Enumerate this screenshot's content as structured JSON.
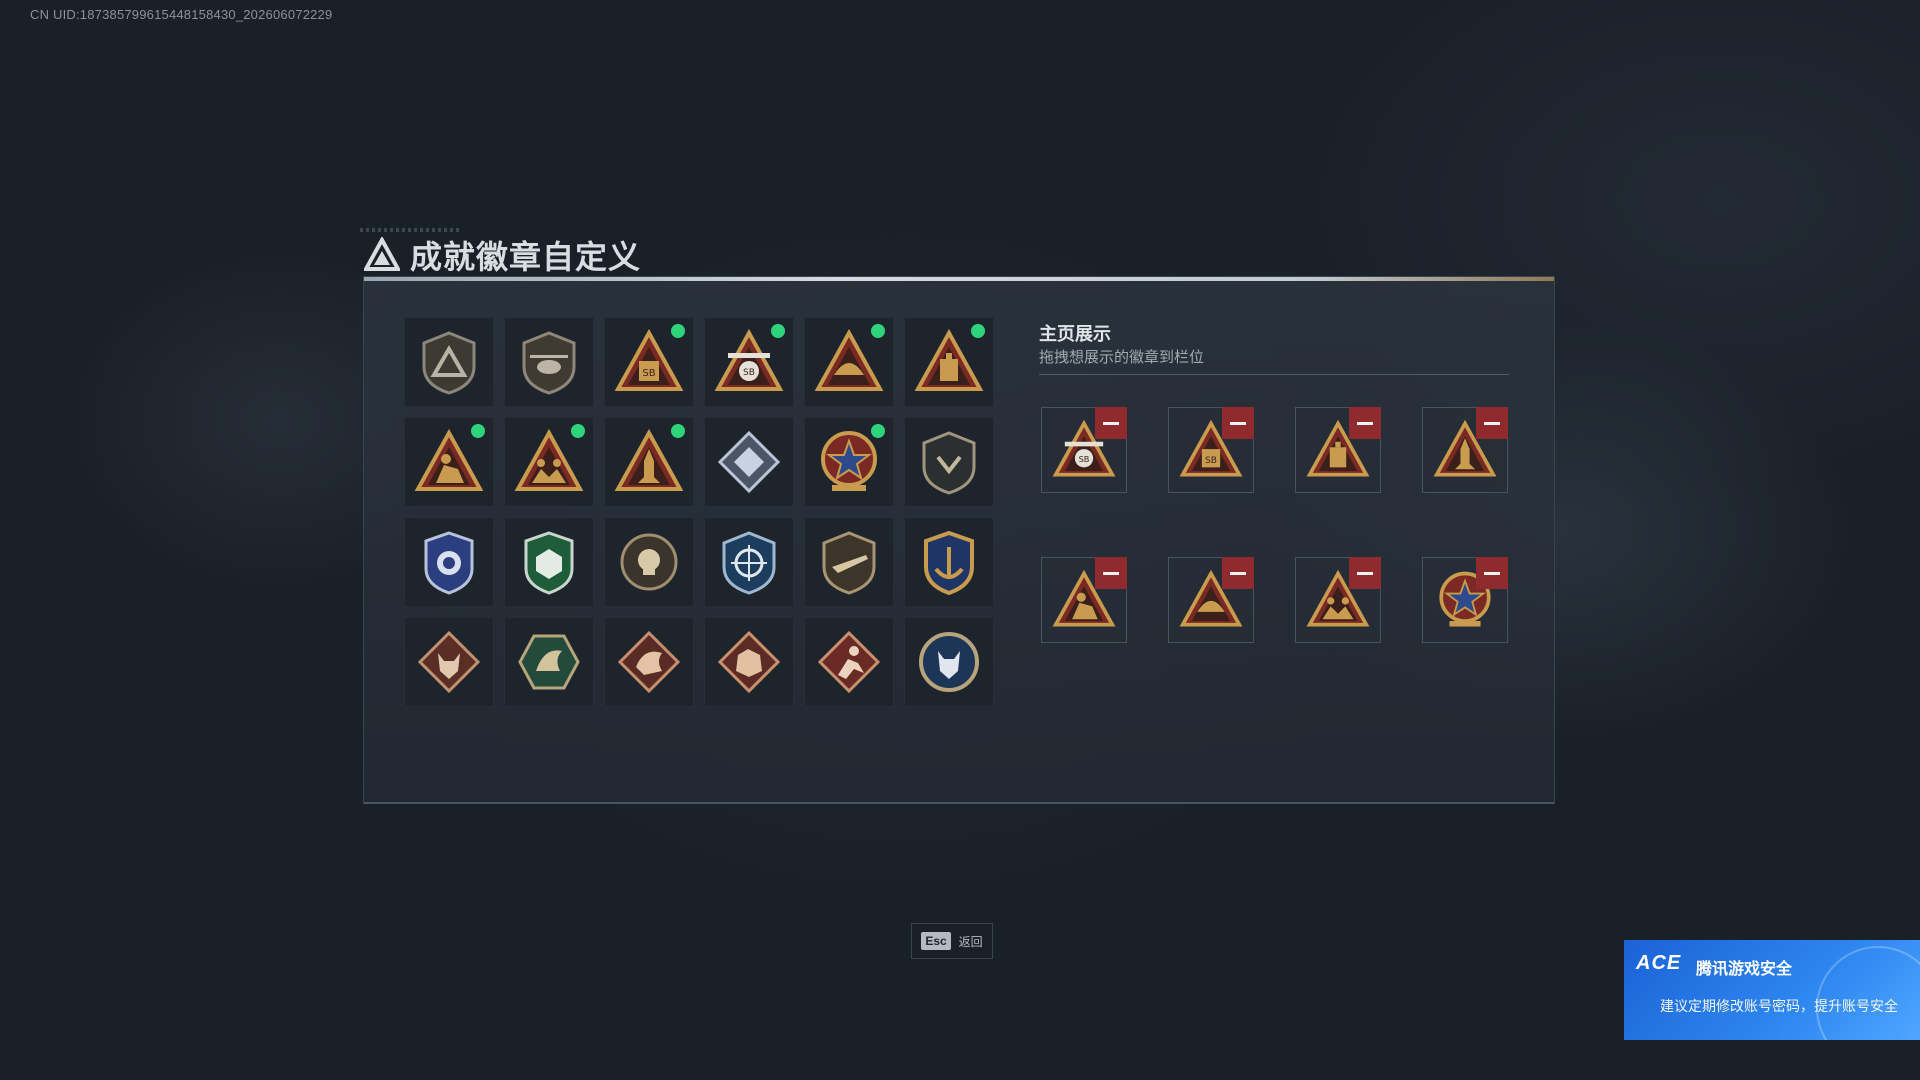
{
  "uid_text": "CN UID:187385799615448158430_202606072229",
  "title": "成就徽章自定义",
  "colors": {
    "selected_dot": "#2fd37c",
    "remove_bg": "#8f2a2e",
    "gold": "#c89b4e",
    "red": "#7a2a23",
    "notice_bg": "#2e86f0"
  },
  "badges": [
    {
      "icon": "gray-shield-triangle-badge-icon",
      "selected": false
    },
    {
      "icon": "helicopter-shield-badge-icon",
      "selected": false
    },
    {
      "icon": "sb-crate-triangle-badge-icon",
      "selected": true
    },
    {
      "icon": "sb-drone-triangle-badge-icon",
      "selected": true
    },
    {
      "icon": "helmet-triangle-badge-icon",
      "selected": true
    },
    {
      "icon": "box-triangle-badge-icon",
      "selected": true
    },
    {
      "icon": "soldier-triangle-badge-icon",
      "selected": true
    },
    {
      "icon": "squad-triangle-badge-icon",
      "selected": true
    },
    {
      "icon": "rocket-triangle-badge-icon",
      "selected": true
    },
    {
      "icon": "dice-diamond-badge-icon",
      "selected": false
    },
    {
      "icon": "star-wreath-badge-icon",
      "selected": true
    },
    {
      "icon": "dark-shield-badge-icon",
      "selected": false
    },
    {
      "icon": "blue-police-badge-icon",
      "selected": false
    },
    {
      "icon": "green-shield-badge-icon",
      "selected": false
    },
    {
      "icon": "skull-medal-badge-icon",
      "selected": false
    },
    {
      "icon": "crosshair-shield-badge-icon",
      "selected": false
    },
    {
      "icon": "rifle-shield-badge-icon",
      "selected": false
    },
    {
      "icon": "gold-anchor-badge-icon",
      "selected": false
    },
    {
      "icon": "wolf-diamond-badge-icon",
      "selected": false
    },
    {
      "icon": "dragon-hexagon-badge-icon",
      "selected": false
    },
    {
      "icon": "dragon-diamond-badge-icon",
      "selected": false
    },
    {
      "icon": "beast-diamond-badge-icon",
      "selected": false
    },
    {
      "icon": "runner-diamond-badge-icon",
      "selected": false
    },
    {
      "icon": "wolf-circle-badge-icon",
      "selected": false
    }
  ],
  "showcase": {
    "title": "主页展示",
    "subtitle": "拖拽想展示的徽章到栏位",
    "slots": [
      {
        "icon": "sb-drone-triangle-badge-icon"
      },
      {
        "icon": "sb-crate-triangle-badge-icon"
      },
      {
        "icon": "box-triangle-badge-icon"
      },
      {
        "icon": "rocket-triangle-badge-icon"
      },
      {
        "icon": "soldier-triangle-badge-icon"
      },
      {
        "icon": "helmet-triangle-badge-icon"
      },
      {
        "icon": "squad-triangle-badge-icon"
      },
      {
        "icon": "star-wreath-badge-icon"
      }
    ]
  },
  "esc": {
    "key": "Esc",
    "label": "返回"
  },
  "notice": {
    "logo": "ACE",
    "title": "腾讯游戏安全",
    "text": "建议定期修改账号密码，提升账号安全"
  }
}
